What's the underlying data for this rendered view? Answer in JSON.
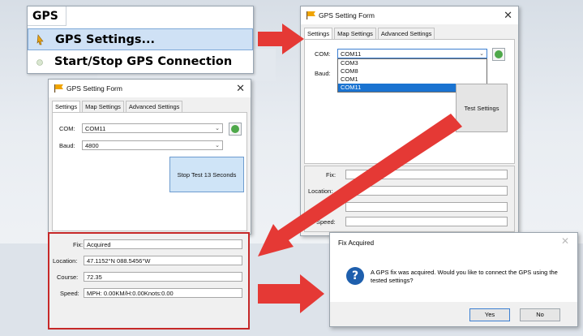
{
  "menu": {
    "title": "GPS",
    "items": [
      {
        "label": "GPS Settings..."
      },
      {
        "label": "Start/Stop GPS Connection"
      }
    ]
  },
  "formA": {
    "title": "GPS Setting Form",
    "tabs": [
      "Settings",
      "Map Settings",
      "Advanced Settings"
    ],
    "com_label": "COM:",
    "com_value": "COM11",
    "baud_label": "Baud:",
    "dropdown_options": [
      "COM3",
      "COM8",
      "COM1",
      "COM11"
    ],
    "test_button": "Test Settings",
    "fields": [
      {
        "label": "Fix:"
      },
      {
        "label": "Location:"
      },
      {
        "label": ""
      },
      {
        "label": "Speed:"
      }
    ]
  },
  "formB": {
    "title": "GPS Setting Form",
    "tabs": [
      "Settings",
      "Map Settings",
      "Advanced Settings"
    ],
    "com_label": "COM:",
    "com_value": "COM11",
    "baud_label": "Baud:",
    "baud_value": "4800",
    "test_button": "Stop Test 13 Seconds",
    "fields": [
      {
        "label": "Fix:",
        "value": "Acquired"
      },
      {
        "label": "Location:",
        "value": "47.1152°N 088.5456°W"
      },
      {
        "label": "Course:",
        "value": "72.35"
      },
      {
        "label": "Speed:",
        "value": "MPH: 0.00KM/H:0.00Knots:0.00"
      }
    ]
  },
  "dialog": {
    "title": "Fix Acquired",
    "message": "A GPS fix was acquired. Would you like to connect the GPS using the tested settings?",
    "yes": "Yes",
    "no": "No"
  },
  "colors": {
    "arrow": "#e53935",
    "frame": "#c62828",
    "highlight": "#1a73d1"
  },
  "icons": [
    "flag-icon",
    "close-icon",
    "gps-globe-icon",
    "question-icon",
    "pointer-icon",
    "chevron-down-icon"
  ]
}
